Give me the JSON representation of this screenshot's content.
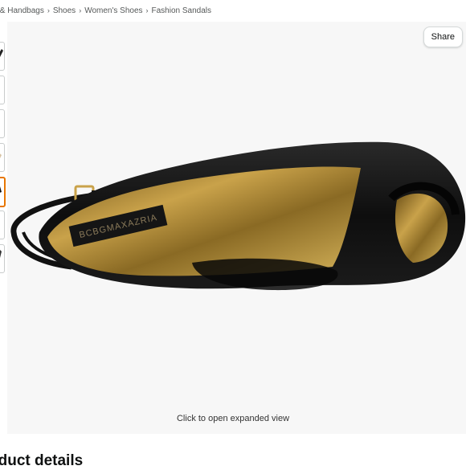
{
  "breadcrumb": {
    "items": [
      "s & Handbags",
      "Shoes",
      "Women's Shoes",
      "Fashion Sandals"
    ],
    "separator": "›"
  },
  "thumbnails": {
    "count": 7,
    "active_index": 4,
    "active_color": "#e77600"
  },
  "viewer": {
    "share_label": "Share",
    "expand_caption": "Click to open expanded view",
    "background": "#f7f7f7"
  },
  "product": {
    "brand_label": "BCBGMAXAZRIA",
    "shoe_color": "#101010",
    "lining_color": "#b8923a"
  },
  "section": {
    "heading": "oduct details"
  }
}
